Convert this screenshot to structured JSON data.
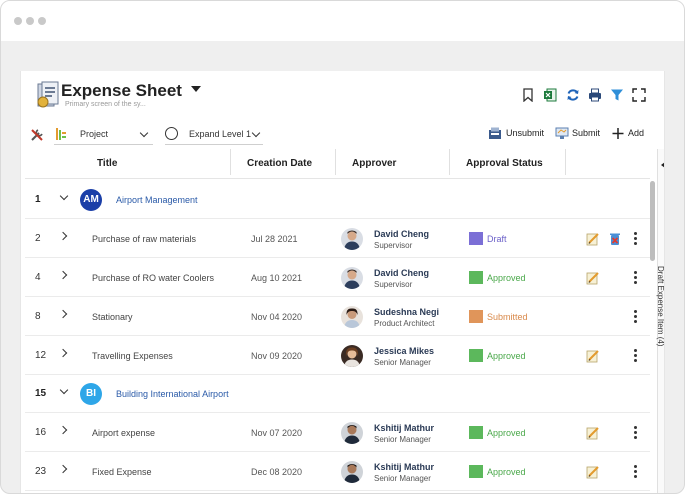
{
  "window": {
    "controls": [
      "dot-1",
      "dot-2",
      "dot-3"
    ]
  },
  "header": {
    "title": "Expense Sheet",
    "subtitle": "Primary screen of the sy...",
    "toolbar_icons": [
      "bookmark-icon",
      "excel-icon",
      "refresh-icon",
      "print-icon",
      "filter-icon",
      "fullscreen-icon"
    ]
  },
  "toolbar": {
    "project_select": "Project",
    "expand_select": "Expand Level 1",
    "unsubmit_label": "Unsubmit",
    "submit_label": "Submit",
    "add_label": "Add"
  },
  "table": {
    "columns": [
      "Title",
      "Creation Date",
      "Approver",
      "Approval Status"
    ],
    "rows": [
      {
        "type": "group",
        "num": "1",
        "initials": "AM",
        "name": "Airport Management",
        "color": "#1b3fa8"
      },
      {
        "type": "item",
        "num": "2",
        "title": "Purchase of raw materials",
        "date": "Jul 28 2021",
        "approver": "David Cheng",
        "role": "Supervisor",
        "status": "Draft",
        "status_color": "#7b6fd6",
        "deletable": true
      },
      {
        "type": "item",
        "num": "4",
        "title": "Purchase of RO water Coolers",
        "date": "Aug 10 2021",
        "approver": "David Cheng",
        "role": "Supervisor",
        "status": "Approved",
        "status_color": "#5cb85c",
        "deletable": false
      },
      {
        "type": "item",
        "num": "8",
        "title": "Stationary",
        "date": "Nov 04 2020",
        "approver": "Sudeshna Negi",
        "role": "Product Architect",
        "status": "Submitted",
        "status_color": "#e0955a",
        "deletable": false
      },
      {
        "type": "item",
        "num": "12",
        "title": "Travelling Expenses",
        "date": "Nov 09 2020",
        "approver": "Jessica Mikes",
        "role": "Senior Manager",
        "status": "Approved",
        "status_color": "#5cb85c",
        "deletable": false
      },
      {
        "type": "group",
        "num": "15",
        "initials": "BI",
        "name": "Building International Airport",
        "color": "#2ea6e8"
      },
      {
        "type": "item",
        "num": "16",
        "title": "Airport expense",
        "date": "Nov 07 2020",
        "approver": "Kshitij Mathur",
        "role": "Senior Manager",
        "status": "Approved",
        "status_color": "#5cb85c",
        "deletable": false
      },
      {
        "type": "item",
        "num": "23",
        "title": "Fixed Expense",
        "date": "Dec 08 2020",
        "approver": "Kshitij Mathur",
        "role": "Senior Manager",
        "status": "Approved",
        "status_color": "#5cb85c",
        "deletable": false
      }
    ]
  },
  "side_panel": {
    "label": "Draft Expense Item (4)"
  }
}
